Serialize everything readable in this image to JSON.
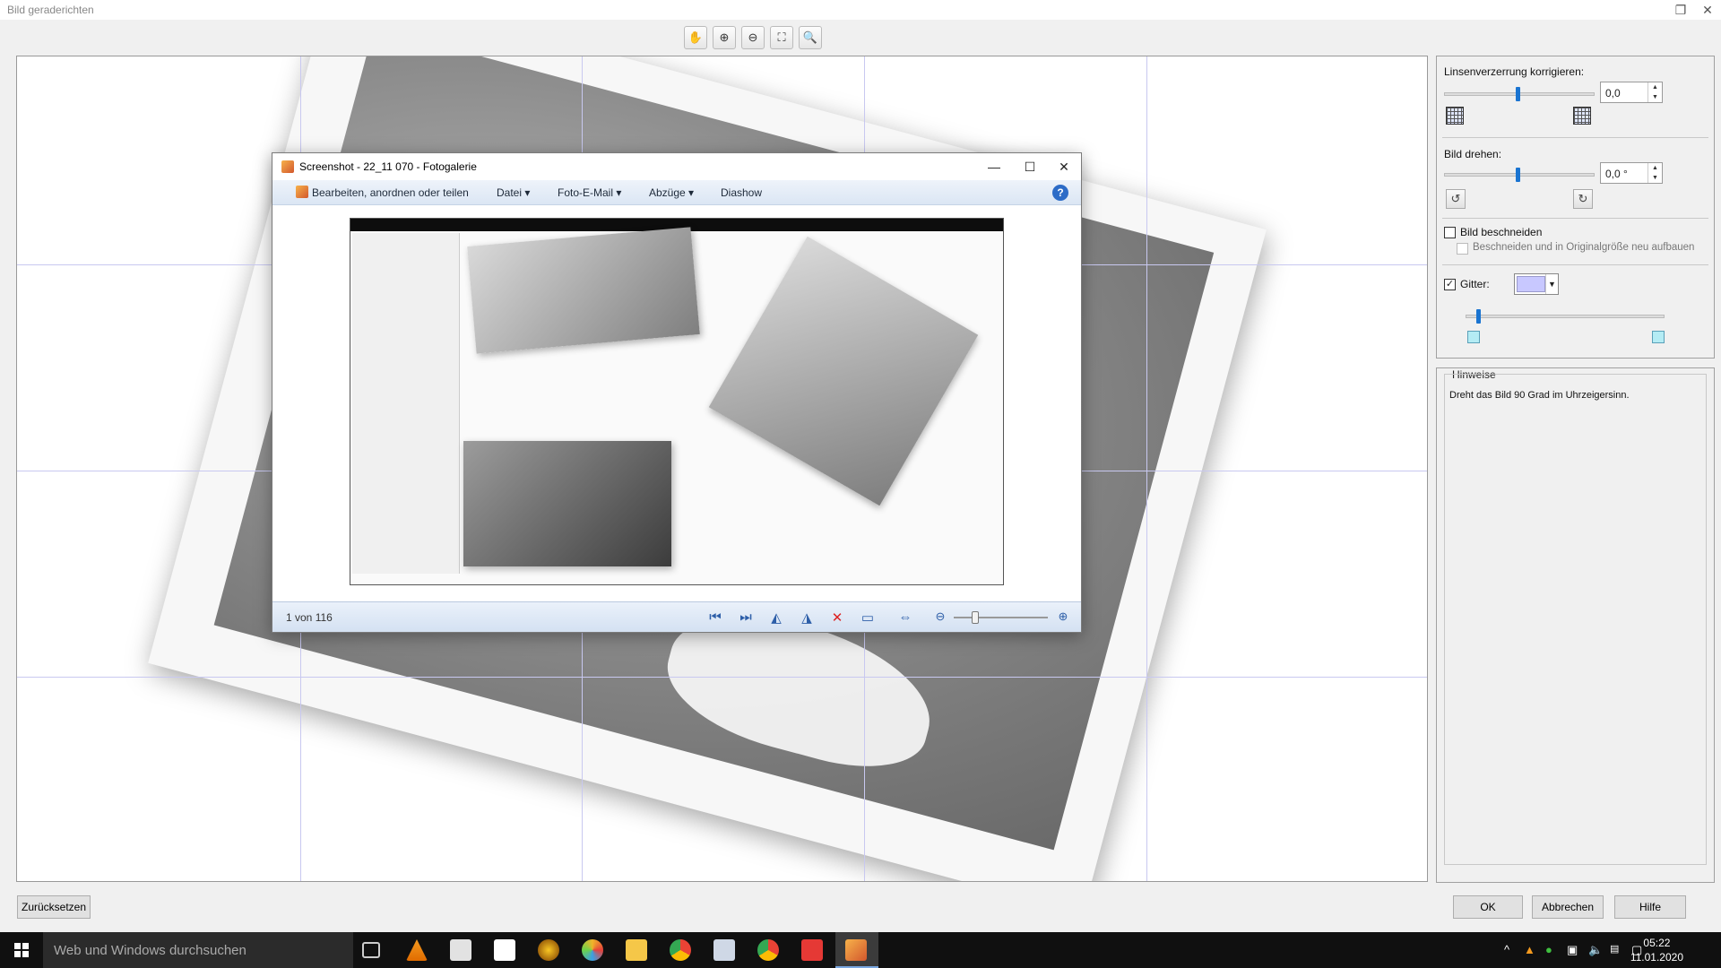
{
  "window": {
    "title": "Bild geraderichten"
  },
  "toolbar": {
    "tools": [
      "hand-icon",
      "zoom-in-icon",
      "zoom-out-icon",
      "fit-icon",
      "actual-size-icon"
    ]
  },
  "inner_window": {
    "title": "Screenshot - 22_11 070 - Fotogalerie",
    "menu": {
      "organize": "Bearbeiten, anordnen oder teilen",
      "file": "Datei",
      "email": "Foto-E-Mail",
      "prints": "Abzüge",
      "slideshow": "Diashow"
    },
    "help": "?",
    "count": "1 von 116"
  },
  "panel": {
    "lens_label": "Linsenverzerrung korrigieren:",
    "lens_value": "0,0",
    "rotate_label": "Bild drehen:",
    "rotate_value": "0,0 °",
    "crop_label": "Bild beschneiden",
    "crop_rebuild_label": "Beschneiden und in Originalgröße neu aufbauen",
    "grid_label": "Gitter:",
    "grid_color": "#c8c8ff"
  },
  "hints": {
    "title": "Hinweise",
    "text": "Dreht das Bild 90 Grad im Uhrzeigersinn."
  },
  "buttons": {
    "reset": "Zurücksetzen",
    "ok": "OK",
    "cancel": "Abbrechen",
    "help": "Hilfe"
  },
  "taskbar": {
    "search_placeholder": "Web und Windows durchsuchen",
    "time": "05:22",
    "date": "11.01.2020"
  }
}
